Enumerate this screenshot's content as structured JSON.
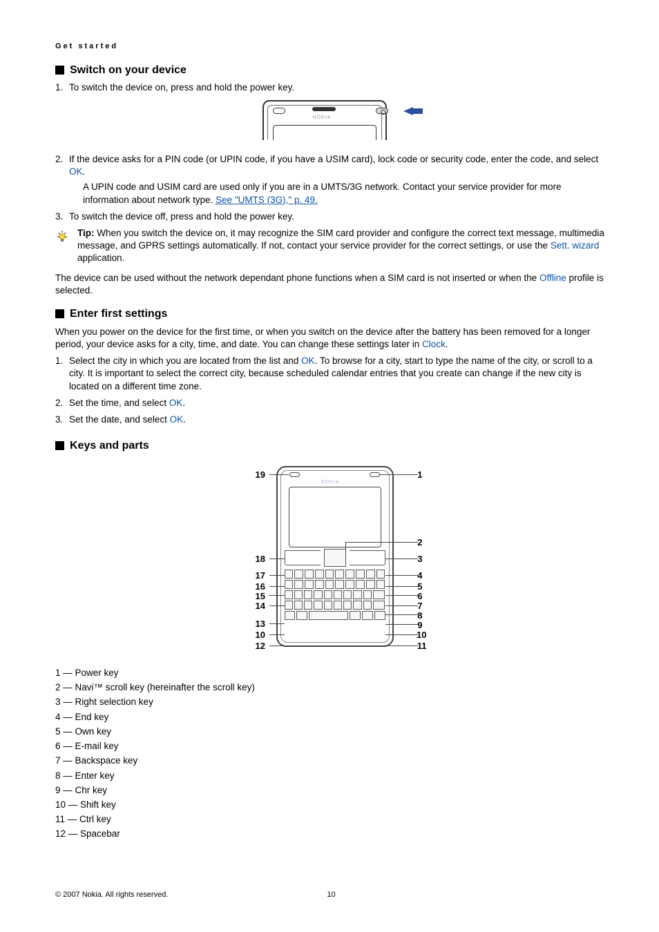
{
  "header": {
    "breadcrumb": "Get started"
  },
  "sec1": {
    "title": "Switch on your device",
    "step1": "To switch the device on, press and hold the power key.",
    "step2_a": "If the device asks for a PIN code (or UPIN code, if you have a USIM card), lock code or security code, enter the code, and select ",
    "ok": "OK",
    "step2_b": ".",
    "step2_sub_a": "A UPIN code and USIM card are used only if you are in a UMTS/3G network. Contact your service provider for more information about network type. ",
    "step2_link": "See \"UMTS (3G),\" p. 49.",
    "step3": "To switch the device off, press and hold the power key.",
    "tip_label": "Tip: ",
    "tip_a": "When you switch the device on, it may recognize the SIM card provider and configure the correct text message, multimedia message, and GPRS settings automatically. If not, contact your service provider for the correct settings, or use the ",
    "sett": "Sett. wizard",
    "tip_b": " application.",
    "closing_a": "The device can be used without the network dependant phone functions when a SIM card is not inserted or when the ",
    "offline": "Offline",
    "closing_b": " profile is selected.",
    "nokia": "NOKIA"
  },
  "sec2": {
    "title": "Enter first settings",
    "intro_a": "When you power on the device for the first time, or when you switch on the device after the battery has been removed for a longer period, your device asks for a city, time, and date. You can change these settings later in ",
    "clock": "Clock",
    "intro_b": ".",
    "step1_a": "Select the city in which you are located from the list and ",
    "ok": "OK",
    "step1_b": ". To browse for a city, start to type the name of the city, or scroll to a city. It is important to select the correct city, because scheduled calendar entries that you create can change if the new city is located on a different time zone.",
    "step2_a": "Set the time, and select ",
    "step2_b": ".",
    "step3_a": "Set the date, and select ",
    "step3_b": "."
  },
  "sec3": {
    "title": "Keys and parts",
    "nokia": "NOKIA",
    "labels": {
      "n1": "1",
      "n2": "2",
      "n3": "3",
      "n4": "4",
      "n5": "5",
      "n6": "6",
      "n7": "7",
      "n8": "8",
      "n9": "9",
      "n10": "10",
      "n11": "11",
      "n12": "12",
      "n13": "13",
      "n14": "14",
      "n15": "15",
      "n16": "16",
      "n17": "17",
      "n18": "18",
      "n19": "19"
    },
    "list": [
      "1 — Power key",
      "2 — Navi™ scroll key (hereinafter the scroll key)",
      "3 — Right selection key",
      "4 — End key",
      "5 — Own key",
      "6 — E-mail key",
      "7 — Backspace key",
      "8 — Enter key",
      "9 — Chr key",
      "10 — Shift key",
      "11 — Ctrl key",
      "12 — Spacebar"
    ]
  },
  "footer": {
    "copyright": "© 2007 Nokia. All rights reserved.",
    "page": "10"
  }
}
